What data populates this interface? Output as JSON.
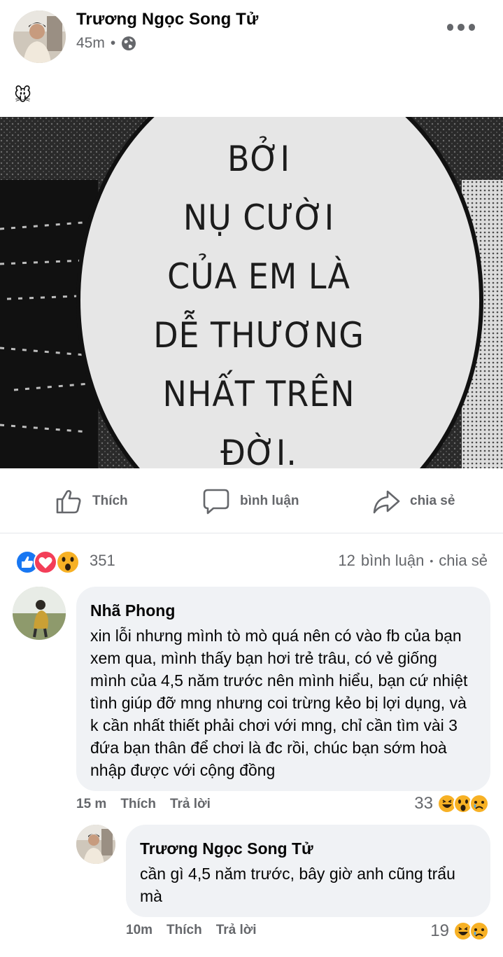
{
  "post": {
    "author": "Trương Ngọc Song Tử",
    "time": "45m",
    "separator": "•",
    "caption": "🐭",
    "image_text": [
      "BỞI",
      "NỤ CƯỜI",
      "CỦA EM LÀ",
      "DỄ THƯƠNG",
      "NHẤT TRÊN",
      "ĐỜI."
    ]
  },
  "actions": {
    "like": "Thích",
    "comment": "bình luận",
    "share": "chia sẻ"
  },
  "stats": {
    "reaction_count": "351",
    "comment_count": "12",
    "comment_label": "bình luận",
    "dot": "•",
    "share_label": "chia sẻ"
  },
  "comments": [
    {
      "name": "Nhã Phong",
      "text": "xin lỗi nhưng mình tò mò quá nên có vào fb của bạn xem qua, mình thấy bạn hơi trẻ trâu, có vẻ giống mình của 4,5 năm trước nên mình hiểu, bạn cứ nhiệt tình giúp đỡ mng nhưng coi trừng kẻo bị lợi dụng, và k cần nhất thiết phải chơi với mng, chỉ cần tìm vài 3 đứa bạn thân để chơi là đc rồi, chúc bạn sớm hoà nhập được với cộng đồng",
      "time": "15 m",
      "like": "Thích",
      "reply": "Trả lời",
      "reactions": "33"
    },
    {
      "name": "Trương Ngọc Song Tử",
      "text": "cần gì 4,5 năm trước, bây giờ anh cũng trẩu mà",
      "time": "10m",
      "like": "Thích",
      "reply": "Trả lời",
      "reactions": "19"
    }
  ],
  "colors": {
    "secondary_text": "#65676b",
    "bubble_bg": "#f0f2f5",
    "like_blue": "#1877f2",
    "love_red": "#f33e58",
    "haha_yellow": "#f7b125"
  },
  "icons": [
    "globe-icon",
    "more-icon",
    "like-icon",
    "comment-icon",
    "share-icon",
    "like-reaction-icon",
    "love-reaction-icon",
    "wow-reaction-icon",
    "haha-reaction-icon",
    "sad-reaction-icon"
  ]
}
